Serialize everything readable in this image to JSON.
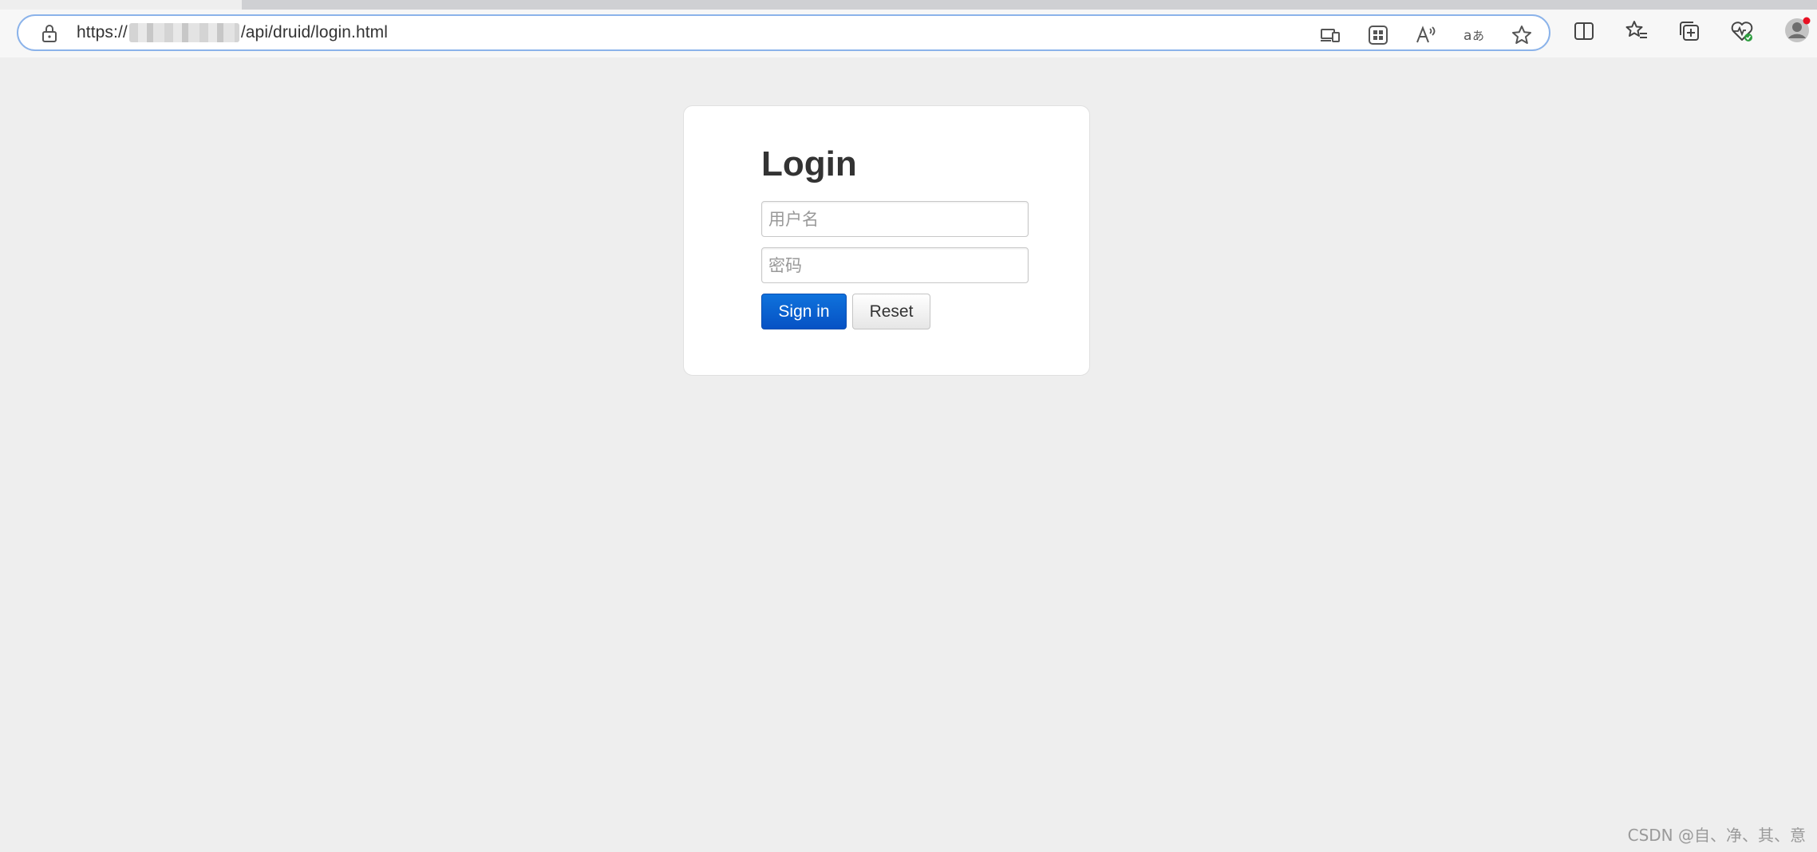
{
  "browser": {
    "url_prefix": "https://",
    "url_suffix": "/api/druid/login.html",
    "icons": {
      "lock": "lock-icon",
      "device": "device-icon",
      "apps": "apps-icon",
      "read_aloud": "read-aloud-icon",
      "translate": "translate-icon",
      "favorite": "star-icon",
      "split_screen": "split-screen-icon",
      "favorites_list": "favorites-list-icon",
      "collections": "collections-icon",
      "health": "browser-essentials-icon",
      "profile": "profile-avatar-icon"
    },
    "colors": {
      "address_border": "#8bb3ea",
      "profile_badge": "#e81123",
      "health_badge": "#2e9d3f"
    }
  },
  "login": {
    "title": "Login",
    "username_placeholder": "用户名",
    "password_placeholder": "密码",
    "signin_label": "Sign in",
    "reset_label": "Reset",
    "colors": {
      "signin_bg": "#0a63d4"
    }
  },
  "watermark": "CSDN @自、净、其、意"
}
